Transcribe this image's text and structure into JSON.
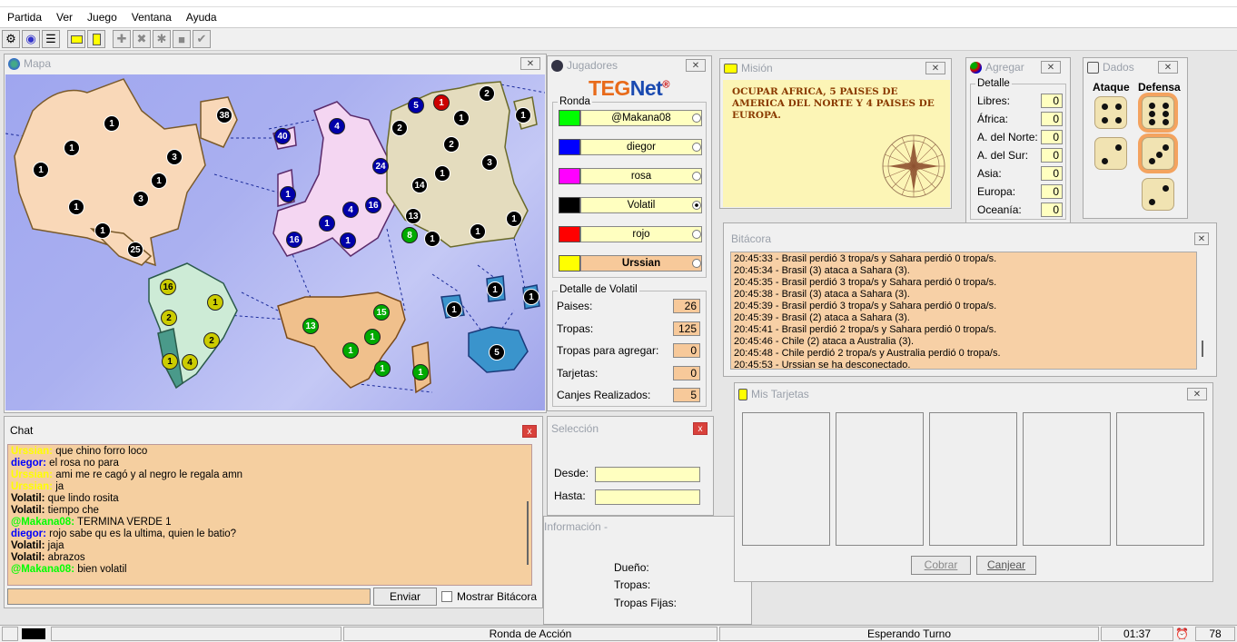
{
  "app": {
    "title": "TEGNet"
  },
  "menu": [
    "Partida",
    "Ver",
    "Juego",
    "Ventana",
    "Ayuda"
  ],
  "toolbar": {
    "icons": [
      "connect-icon",
      "globe-icon",
      "list-icon",
      "card-yellow-icon",
      "card-icon",
      "add-icon",
      "attack-icon",
      "regroup-icon",
      "cards-icon",
      "end-turn-icon"
    ]
  },
  "map": {
    "title": "Mapa"
  },
  "chat": {
    "title": "Chat",
    "lines": [
      {
        "user": "Urssian:",
        "text": "que chino forro loco",
        "color": "#ffff00"
      },
      {
        "user": "diegor:",
        "text": "el rosa no para",
        "color": "#0000ff"
      },
      {
        "user": "Urssian:",
        "text": "ami me re cagó y al negro le regala amn",
        "color": "#ffff00"
      },
      {
        "user": "Urssian:",
        "text": "ja",
        "color": "#ffff00"
      },
      {
        "user": "Volatil:",
        "text": "que lindo rosita",
        "color": "#000000"
      },
      {
        "user": "Volatil:",
        "text": "tiempo che",
        "color": "#000000"
      },
      {
        "user": "@Makana08:",
        "text": "TERMINA VERDE 1",
        "color": "#00ff00"
      },
      {
        "user": "diegor:",
        "text": "rojo sabe qu es la ultima, quien le batio?",
        "color": "#0000ff"
      },
      {
        "user": "Volatil:",
        "text": "jaja",
        "color": "#000000"
      },
      {
        "user": "Volatil:",
        "text": "abrazos",
        "color": "#000000"
      },
      {
        "user": "@Makana08:",
        "text": "bien volatil",
        "color": "#00ff00"
      }
    ],
    "input_value": "",
    "send_label": "Enviar",
    "show_log_label": "Mostrar Bitácora"
  },
  "players": {
    "title": "Jugadores",
    "logo_teg": "TEG",
    "logo_net": "Net",
    "logo_reg": "®",
    "round_label": "Ronda",
    "list": [
      {
        "name": "@Makana08",
        "color": "#00ff00"
      },
      {
        "name": "diegor",
        "color": "#0000ff"
      },
      {
        "name": "rosa",
        "color": "#ff00ff"
      },
      {
        "name": "Volatil",
        "color": "#000000"
      },
      {
        "name": "rojo",
        "color": "#ff0000"
      },
      {
        "name": "Urssian",
        "color": "#ffff00"
      }
    ],
    "detail_title": "Detalle de Volatil",
    "details": [
      {
        "label": "Paises:",
        "value": "26"
      },
      {
        "label": "Tropas:",
        "value": "125"
      },
      {
        "label": "Tropas para agregar:",
        "value": "0"
      },
      {
        "label": "Tarjetas:",
        "value": "0"
      },
      {
        "label": "Canjes Realizados:",
        "value": "5"
      }
    ]
  },
  "selection": {
    "title": "Selección",
    "from_label": "Desde:",
    "to_label": "Hasta:",
    "from_value": "",
    "to_value": ""
  },
  "info": {
    "title": "Información -",
    "owner_label": "Dueño:",
    "troops_label": "Tropas:",
    "fixed_label": "Tropas Fijas:"
  },
  "mission": {
    "title": "Misión",
    "text": "OCUPAR AFRICA, 5 PAISES DE AMERICA DEL NORTE Y 4 PAISES DE EUROPA."
  },
  "add": {
    "title": "Agregar",
    "detail_label": "Detalle",
    "rows": [
      {
        "label": "Libres:",
        "value": "0"
      },
      {
        "label": "África:",
        "value": "0"
      },
      {
        "label": "A. del Norte:",
        "value": "0"
      },
      {
        "label": "A. del Sur:",
        "value": "0"
      },
      {
        "label": "Asia:",
        "value": "0"
      },
      {
        "label": "Europa:",
        "value": "0"
      },
      {
        "label": "Oceanía:",
        "value": "0"
      }
    ]
  },
  "dice": {
    "title": "Dados",
    "attack_label": "Ataque",
    "defense_label": "Defensa",
    "attack": [
      4,
      2
    ],
    "defense": [
      6,
      3,
      2
    ]
  },
  "log": {
    "title": "Bitácora",
    "lines": [
      "20:45:33 - Brasil perdió 3 tropa/s y Sahara perdió 0 tropa/s.",
      "20:45:34 - Brasil (3) ataca a Sahara (3).",
      "20:45:35 - Brasil perdió 3 tropa/s y Sahara perdió 0 tropa/s.",
      "20:45:38 - Brasil (3) ataca a Sahara (3).",
      "20:45:39 - Brasil perdió 3 tropa/s y Sahara perdió 0 tropa/s.",
      "20:45:39 - Brasil (2) ataca a Sahara (3).",
      "20:45:41 - Brasil perdió 2 tropa/s y Sahara perdió 0 tropa/s.",
      "20:45:46 - Chile (2) ataca a Australia (3).",
      "20:45:48 - Chile perdió 2 tropa/s y Australia perdió 0 tropa/s.",
      "20:45:53 - Urssian se ha desconectado."
    ]
  },
  "cards": {
    "title": "Mis Tarjetas",
    "collect_label": "Cobrar",
    "exchange_label": "Canjear"
  },
  "status": {
    "round": "Ronda de Acción",
    "state": "Esperando Turno",
    "time": "01:37",
    "count": "78"
  },
  "armies": [
    {
      "n": "1",
      "c": "#000000"
    },
    {
      "n": "38",
      "c": "#000000"
    },
    {
      "n": "1",
      "c": "#000000"
    },
    {
      "n": "1",
      "c": "#000000"
    },
    {
      "n": "3",
      "c": "#000000"
    },
    {
      "n": "1",
      "c": "#000000"
    },
    {
      "n": "3",
      "c": "#000000"
    },
    {
      "n": "1",
      "c": "#000000"
    },
    {
      "n": "1",
      "c": "#000000"
    },
    {
      "n": "25",
      "c": "#000000"
    },
    {
      "n": "40",
      "c": "#0000aa"
    },
    {
      "n": "4",
      "c": "#0000aa"
    },
    {
      "n": "1",
      "c": "#0000aa"
    },
    {
      "n": "24",
      "c": "#0000aa"
    },
    {
      "n": "1",
      "c": "#0000aa"
    },
    {
      "n": "4",
      "c": "#0000aa"
    },
    {
      "n": "16",
      "c": "#0000aa"
    },
    {
      "n": "16",
      "c": "#0000aa"
    },
    {
      "n": "1",
      "c": "#0000aa"
    },
    {
      "n": "5",
      "c": "#0000aa"
    },
    {
      "n": "1",
      "c": "#cc0000"
    },
    {
      "n": "2",
      "c": "#000000"
    },
    {
      "n": "1",
      "c": "#000000"
    },
    {
      "n": "2",
      "c": "#000000"
    },
    {
      "n": "2",
      "c": "#000000"
    },
    {
      "n": "1",
      "c": "#000000"
    },
    {
      "n": "1",
      "c": "#000000"
    },
    {
      "n": "3",
      "c": "#000000"
    },
    {
      "n": "14",
      "c": "#000000"
    },
    {
      "n": "13",
      "c": "#000000"
    },
    {
      "n": "8",
      "c": "#00aa00"
    },
    {
      "n": "1",
      "c": "#000000"
    },
    {
      "n": "1",
      "c": "#000000"
    },
    {
      "n": "1",
      "c": "#000000"
    },
    {
      "n": "16",
      "c": "#cccc00"
    },
    {
      "n": "1",
      "c": "#cccc00"
    },
    {
      "n": "2",
      "c": "#cccc00"
    },
    {
      "n": "2",
      "c": "#cccc00"
    },
    {
      "n": "1",
      "c": "#cccc00"
    },
    {
      "n": "4",
      "c": "#cccc00"
    },
    {
      "n": "13",
      "c": "#00aa00"
    },
    {
      "n": "15",
      "c": "#00aa00"
    },
    {
      "n": "1",
      "c": "#00aa00"
    },
    {
      "n": "1",
      "c": "#00aa00"
    },
    {
      "n": "1",
      "c": "#00aa00"
    },
    {
      "n": "1",
      "c": "#00aa00"
    },
    {
      "n": "1",
      "c": "#000000"
    },
    {
      "n": "1",
      "c": "#000000"
    },
    {
      "n": "1",
      "c": "#000000"
    },
    {
      "n": "5",
      "c": "#000000"
    }
  ]
}
